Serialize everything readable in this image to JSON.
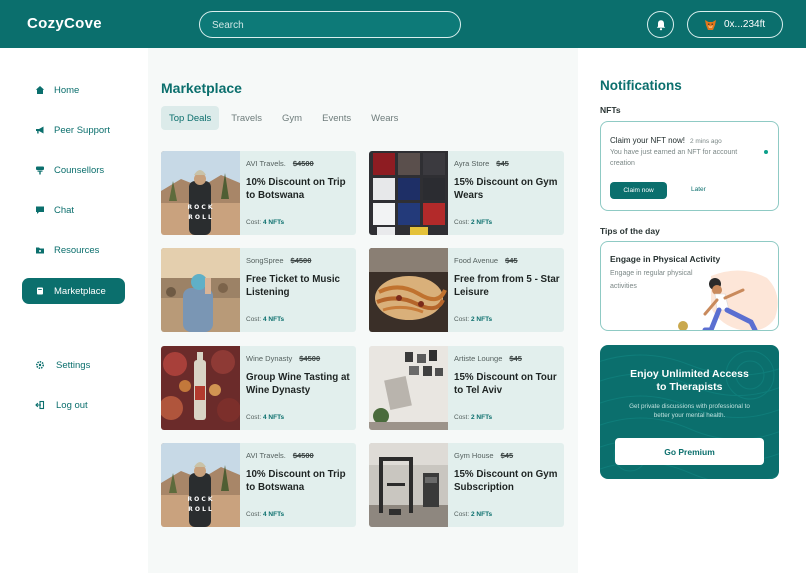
{
  "app": {
    "brand": "CozyCove"
  },
  "header": {
    "search_placeholder": "Search",
    "wallet_address": "0x...234ft"
  },
  "sidebar": {
    "items": [
      {
        "label": "Home",
        "icon": "home-icon"
      },
      {
        "label": "Peer Support",
        "icon": "megaphone-icon"
      },
      {
        "label": "Counsellors",
        "icon": "chair-icon"
      },
      {
        "label": "Chat",
        "icon": "chat-icon"
      },
      {
        "label": "Resources",
        "icon": "folder-icon"
      },
      {
        "label": "Marketplace",
        "icon": "cart-icon",
        "active": true
      }
    ],
    "bottom_items": [
      {
        "label": "Settings",
        "icon": "gear-icon"
      },
      {
        "label": "Log out",
        "icon": "logout-icon"
      }
    ]
  },
  "main": {
    "title": "Marketplace",
    "tabs": [
      {
        "label": "Top Deals",
        "active": true
      },
      {
        "label": "Travels"
      },
      {
        "label": "Gym"
      },
      {
        "label": "Events"
      },
      {
        "label": "Wears"
      }
    ],
    "cards": [
      {
        "vendor": "AVI Travels.",
        "old_price": "$4500",
        "title": "10% Discount on Trip to Botswana",
        "cost_label": "Cost:",
        "cost_value": "4 NFTs",
        "image": "desert-photo"
      },
      {
        "vendor": "Ayra Store",
        "old_price": "$45",
        "title": "15% Discount on Gym Wears",
        "cost_label": "Cost:",
        "cost_value": "2 NFTs",
        "image": "shirts-photo"
      },
      {
        "vendor": "SongSpree",
        "old_price": "$4500",
        "title": "Free Ticket to Music Listening",
        "cost_label": "Cost:",
        "cost_value": "4 NFTs",
        "image": "concert-photo"
      },
      {
        "vendor": "Food Avenue",
        "old_price": "$45",
        "title": "Free from from 5 - Star Leisure",
        "cost_label": "Cost:",
        "cost_value": "2 NFTs",
        "image": "food-photo"
      },
      {
        "vendor": "Wine Dynasty",
        "old_price": "$4500",
        "title": "Group Wine Tasting at Wine Dynasty",
        "cost_label": "Cost:",
        "cost_value": "4 NFTs",
        "image": "wine-photo"
      },
      {
        "vendor": "Artiste Lounge",
        "old_price": "$45",
        "title": "15% Discount on Tour to Tel Aviv",
        "cost_label": "Cost:",
        "cost_value": "2 NFTs",
        "image": "gallery-photo"
      },
      {
        "vendor": "AVI Travels.",
        "old_price": "$4500",
        "title": "10% Discount on Trip to Botswana",
        "cost_label": "Cost:",
        "cost_value": "4 NFTs",
        "image": "desert-photo"
      },
      {
        "vendor": "Gym House",
        "old_price": "$45",
        "title": "15% Discount on Gym Subscription",
        "cost_label": "Cost:",
        "cost_value": "2 NFTs",
        "image": "gym-photo"
      }
    ]
  },
  "notifications": {
    "title": "Notifications",
    "nft_section": "NFTs",
    "nft": {
      "heading": "Claim your NFT now!",
      "time": "2 mins ago",
      "body": "You have just earned an NFT for account creation",
      "claim_label": "Claim now",
      "later_label": "Later"
    },
    "tips_section": "Tips of the day",
    "tip": {
      "title": "Engage in Physical Activity",
      "body": "Engage in regular physical activities"
    },
    "premium": {
      "title": "Enjoy Unlimited Access to Therapists",
      "body": "Get private discussions with professional to better your mental health.",
      "button": "Go Premium"
    }
  },
  "colors": {
    "primary": "#0b6f6d",
    "card_bg": "#e2efed",
    "main_bg": "#f6f9f8"
  }
}
